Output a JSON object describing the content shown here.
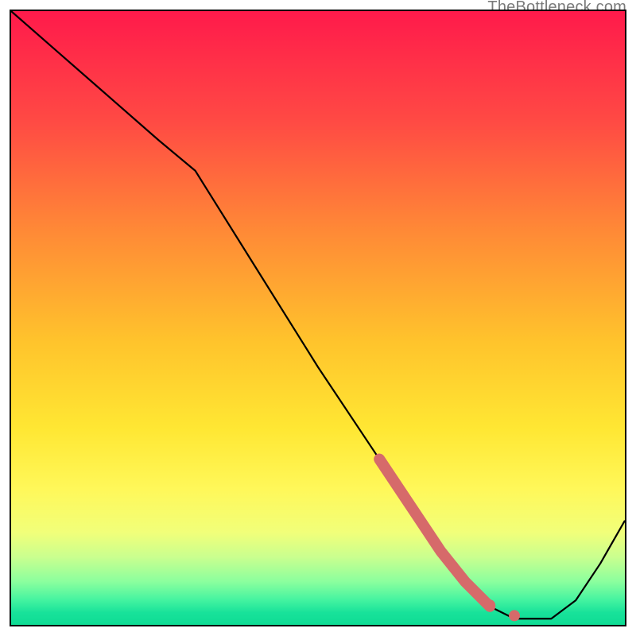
{
  "watermark": "TheBottleneck.com",
  "marker_color": "#d66a6a",
  "line_color": "#000000",
  "chart_data": {
    "type": "line",
    "title": "",
    "xlabel": "",
    "ylabel": "",
    "xlim": [
      0,
      100
    ],
    "ylim": [
      0,
      100
    ],
    "grid": false,
    "legend": false,
    "series": [
      {
        "name": "curve",
        "x": [
          0,
          8,
          16,
          24,
          30,
          40,
          50,
          60,
          66,
          70,
          74,
          78,
          82,
          88,
          92,
          96,
          100
        ],
        "y": [
          100,
          93,
          86,
          79,
          74,
          58,
          42,
          27,
          18,
          12,
          7,
          3,
          1,
          1,
          4,
          10,
          17
        ]
      }
    ],
    "highlight_segment": {
      "name": "thick-red-segment",
      "x": [
        60,
        66,
        70,
        74,
        78
      ],
      "y": [
        27,
        18,
        12,
        7,
        3
      ]
    },
    "markers": [
      {
        "x": 72,
        "y": 9.5
      },
      {
        "x": 78,
        "y": 3.2
      },
      {
        "x": 82,
        "y": 1.5
      }
    ]
  }
}
